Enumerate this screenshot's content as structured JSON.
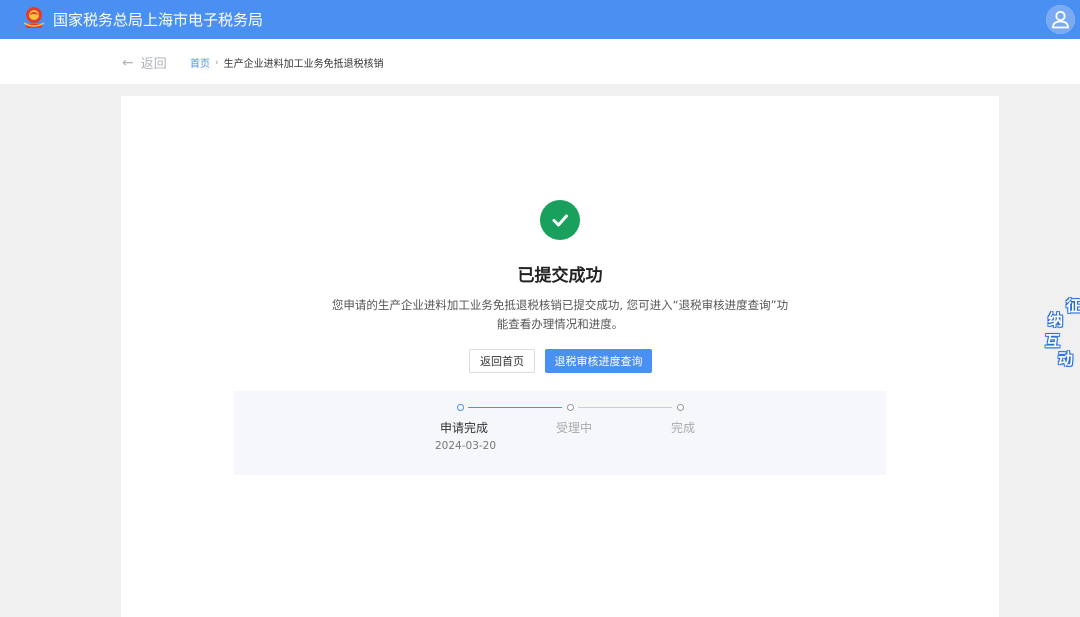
{
  "header": {
    "site_title": "国家税务总局上海市电子税务局",
    "brand_color": "#4a8ff2",
    "logo_icon": "tax-emblem-icon",
    "avatar_icon": "user-icon"
  },
  "nav": {
    "back_label": "返回",
    "back_icon": "arrow-left-icon",
    "breadcrumb": {
      "home": "首页",
      "separator": "›",
      "current": "生产企业进料加工业务免抵退税核销"
    }
  },
  "result": {
    "icon": "check-circle-icon",
    "success_color": "#18a05c",
    "title": "已提交成功",
    "desc_line1": "您申请的生产企业进料加工业务免抵退税核销已提交成功, 您可进入“退税审核进度查询”功",
    "desc_line2": "能查看办理情况和进度。",
    "buttons": {
      "home": "返回首页",
      "query": "退税审核进度查询"
    }
  },
  "steps": [
    {
      "label": "申请完成",
      "date": "2024-03-20",
      "state": "active"
    },
    {
      "label": "受理中",
      "date": "",
      "state": "inactive"
    },
    {
      "label": "完成",
      "date": "",
      "state": "inactive"
    }
  ],
  "float_widget": {
    "chars": [
      "征",
      "纳",
      "互",
      "动"
    ]
  }
}
